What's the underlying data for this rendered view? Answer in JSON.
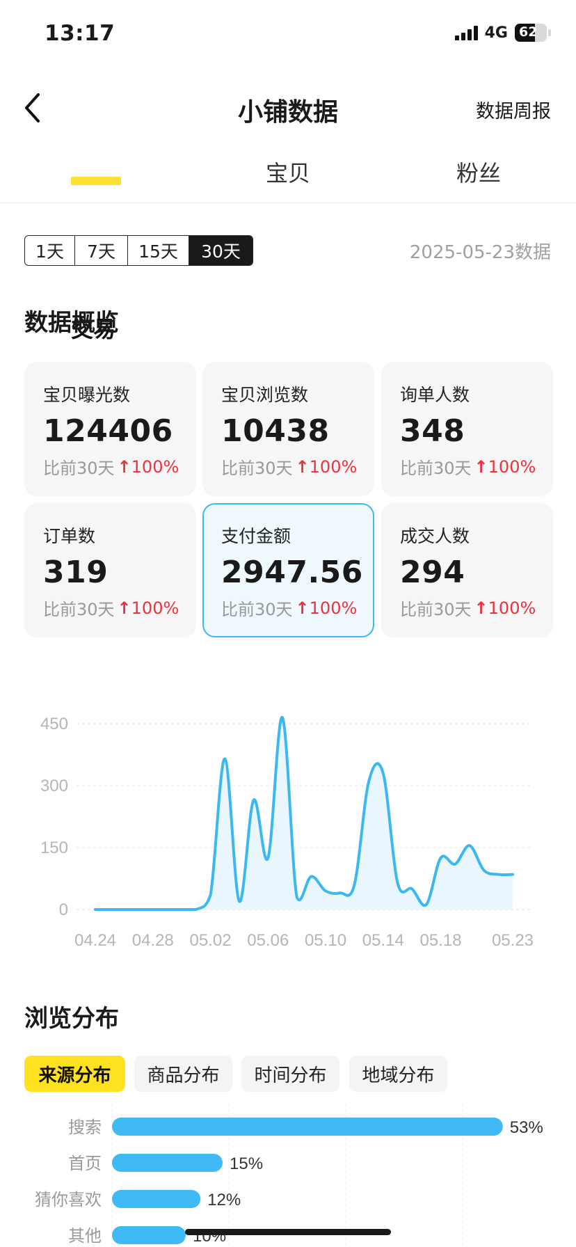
{
  "status": {
    "time": "13:17",
    "network": "4G",
    "battery": "62",
    "battery_level": 0.62
  },
  "nav": {
    "title": "小铺数据",
    "right_link": "数据周报"
  },
  "tabs": [
    {
      "label": "交易",
      "active": true
    },
    {
      "label": "宝贝",
      "active": false
    },
    {
      "label": "粉丝",
      "active": false
    }
  ],
  "range": {
    "options": [
      "1天",
      "7天",
      "15天",
      "30天"
    ],
    "selected": "30天",
    "date_label": "2025-05-23数据"
  },
  "overview": {
    "title": "数据概览",
    "cards": [
      {
        "label": "宝贝曝光数",
        "value": "124406",
        "compare": "比前30天",
        "change": "100%"
      },
      {
        "label": "宝贝浏览数",
        "value": "10438",
        "compare": "比前30天",
        "change": "100%"
      },
      {
        "label": "询单人数",
        "value": "348",
        "compare": "比前30天",
        "change": "100%"
      },
      {
        "label": "订单数",
        "value": "319",
        "compare": "比前30天",
        "change": "100%"
      },
      {
        "label": "支付金额",
        "value": "2947.56",
        "compare": "比前30天",
        "change": "100%",
        "selected": true
      },
      {
        "label": "成交人数",
        "value": "294",
        "compare": "比前30天",
        "change": "100%"
      }
    ]
  },
  "chart_data": [
    {
      "type": "area",
      "x_ticks": [
        "04.24",
        "04.28",
        "05.02",
        "05.06",
        "05.10",
        "05.14",
        "05.18",
        "05.23"
      ],
      "y_ticks": [
        "450",
        "300",
        "150",
        "0"
      ],
      "ylim": [
        0,
        450
      ],
      "x": [
        "04.24",
        "04.25",
        "04.26",
        "04.27",
        "04.28",
        "04.29",
        "04.30",
        "05.01",
        "05.02",
        "05.03",
        "05.04",
        "05.05",
        "05.06",
        "05.07",
        "05.08",
        "05.09",
        "05.10",
        "05.11",
        "05.12",
        "05.13",
        "05.14",
        "05.15",
        "05.16",
        "05.17",
        "05.18",
        "05.19",
        "05.20",
        "05.21",
        "05.22",
        "05.23"
      ],
      "values": [
        0,
        0,
        0,
        0,
        0,
        0,
        0,
        0,
        35,
        365,
        20,
        265,
        125,
        465,
        30,
        80,
        45,
        40,
        60,
        310,
        330,
        65,
        50,
        12,
        125,
        110,
        155,
        95,
        85,
        85
      ],
      "color": "#3cb8f0",
      "fill": "#e9f6fd",
      "grid": true
    },
    {
      "type": "bar",
      "orientation": "horizontal",
      "categories": [
        "搜索",
        "首页",
        "猜你喜欢",
        "其他"
      ],
      "values": [
        53,
        15,
        12,
        10
      ],
      "value_labels": [
        "53%",
        "15%",
        "12%",
        "10%"
      ],
      "color": "#3fbaf5"
    }
  ],
  "distribution": {
    "title": "浏览分布",
    "tabs": [
      {
        "label": "来源分布",
        "active": true
      },
      {
        "label": "商品分布",
        "active": false
      },
      {
        "label": "时间分布",
        "active": false
      },
      {
        "label": "地域分布",
        "active": false
      }
    ]
  },
  "colors": {
    "accent_yellow": "#ffe21f",
    "up_red": "#f0303c",
    "chart_blue": "#3cb8f0"
  },
  "icons": {
    "back": "chevron-left-icon",
    "up": "arrow-up-icon"
  }
}
